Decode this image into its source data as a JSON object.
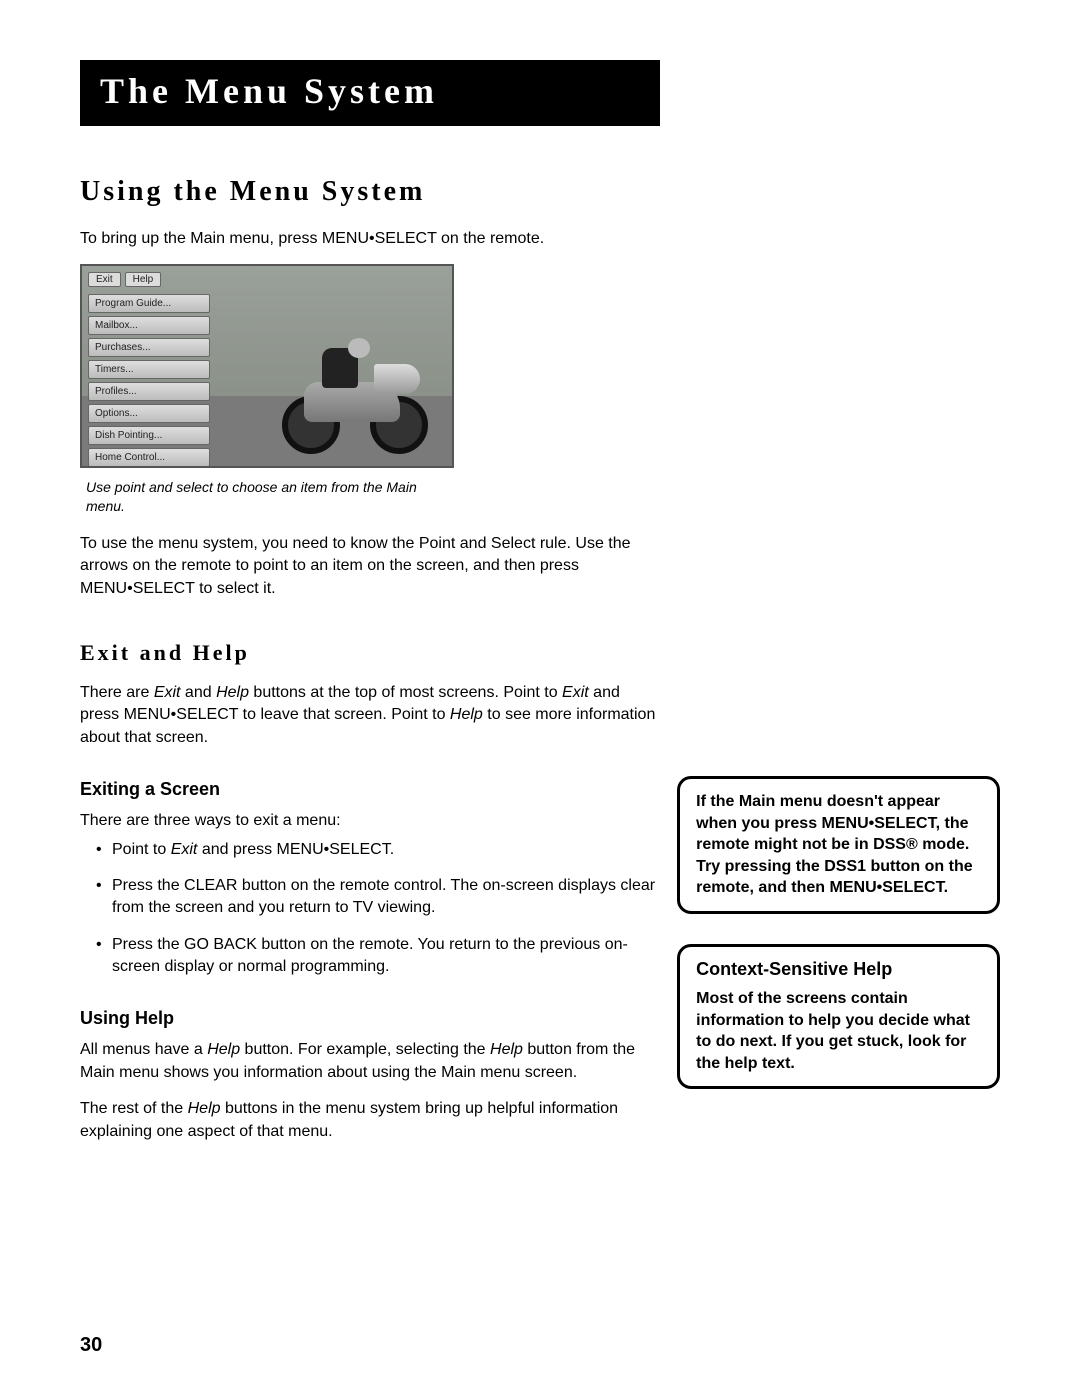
{
  "title": "The Menu System",
  "page_number": "30",
  "screenshot": {
    "top_buttons": [
      "Exit",
      "Help"
    ],
    "menu_items": [
      "Program Guide...",
      "Mailbox...",
      "Purchases...",
      "Timers...",
      "Profiles...",
      "Options...",
      "Dish Pointing...",
      "Home Control..."
    ],
    "caption": "Use point and select to choose an item from the Main menu."
  },
  "section_using": {
    "heading": "Using the Menu System",
    "intro": "To bring up the Main menu, press MENU•SELECT on the remote.",
    "after_image": "To use the menu system, you need to know the Point and Select rule. Use the arrows on the remote to point to an item on the screen, and then press MENU•SELECT to select it."
  },
  "section_exit_help": {
    "heading": "Exit and Help",
    "para_parts": {
      "p1_a": "There are ",
      "p1_b": " and ",
      "p1_c": " buttons at the top of most screens. Point to ",
      "p1_d": " and press MENU•SELECT to leave that screen. Point to ",
      "p1_e": " to see more information about that screen.",
      "exit": "Exit",
      "help": "Help"
    }
  },
  "section_exiting": {
    "heading": "Exiting a Screen",
    "intro": "There are three ways to exit a menu:",
    "bullets": {
      "b1_a": "Point to ",
      "b1_exit": "Exit",
      "b1_b": " and press MENU•SELECT.",
      "b2": "Press the CLEAR button on the remote control. The on-screen displays clear from the screen and you return to TV viewing.",
      "b3": "Press the GO BACK button on the remote. You return to the previous on-screen display or normal programming."
    }
  },
  "section_using_help": {
    "heading": "Using Help",
    "p1_a": "All menus have a ",
    "p1_help": "Help",
    "p1_b": " button. For example, selecting the ",
    "p1_c": " button from the Main menu shows you information about using the Main menu screen.",
    "p2_a": "The rest of the ",
    "p2_b": " buttons in the menu system bring up helpful information explaining one aspect of that menu."
  },
  "sidebar": {
    "tip1": "If the Main menu doesn't appear when you press MENU•SELECT, the remote might not be in DSS® mode. Try pressing the DSS1 button on the remote, and then MENU•SELECT.",
    "tip2_title": "Context-Sensitive Help",
    "tip2_text": "Most of the screens contain information to help you decide what to do next. If you get stuck, look for the help text."
  }
}
